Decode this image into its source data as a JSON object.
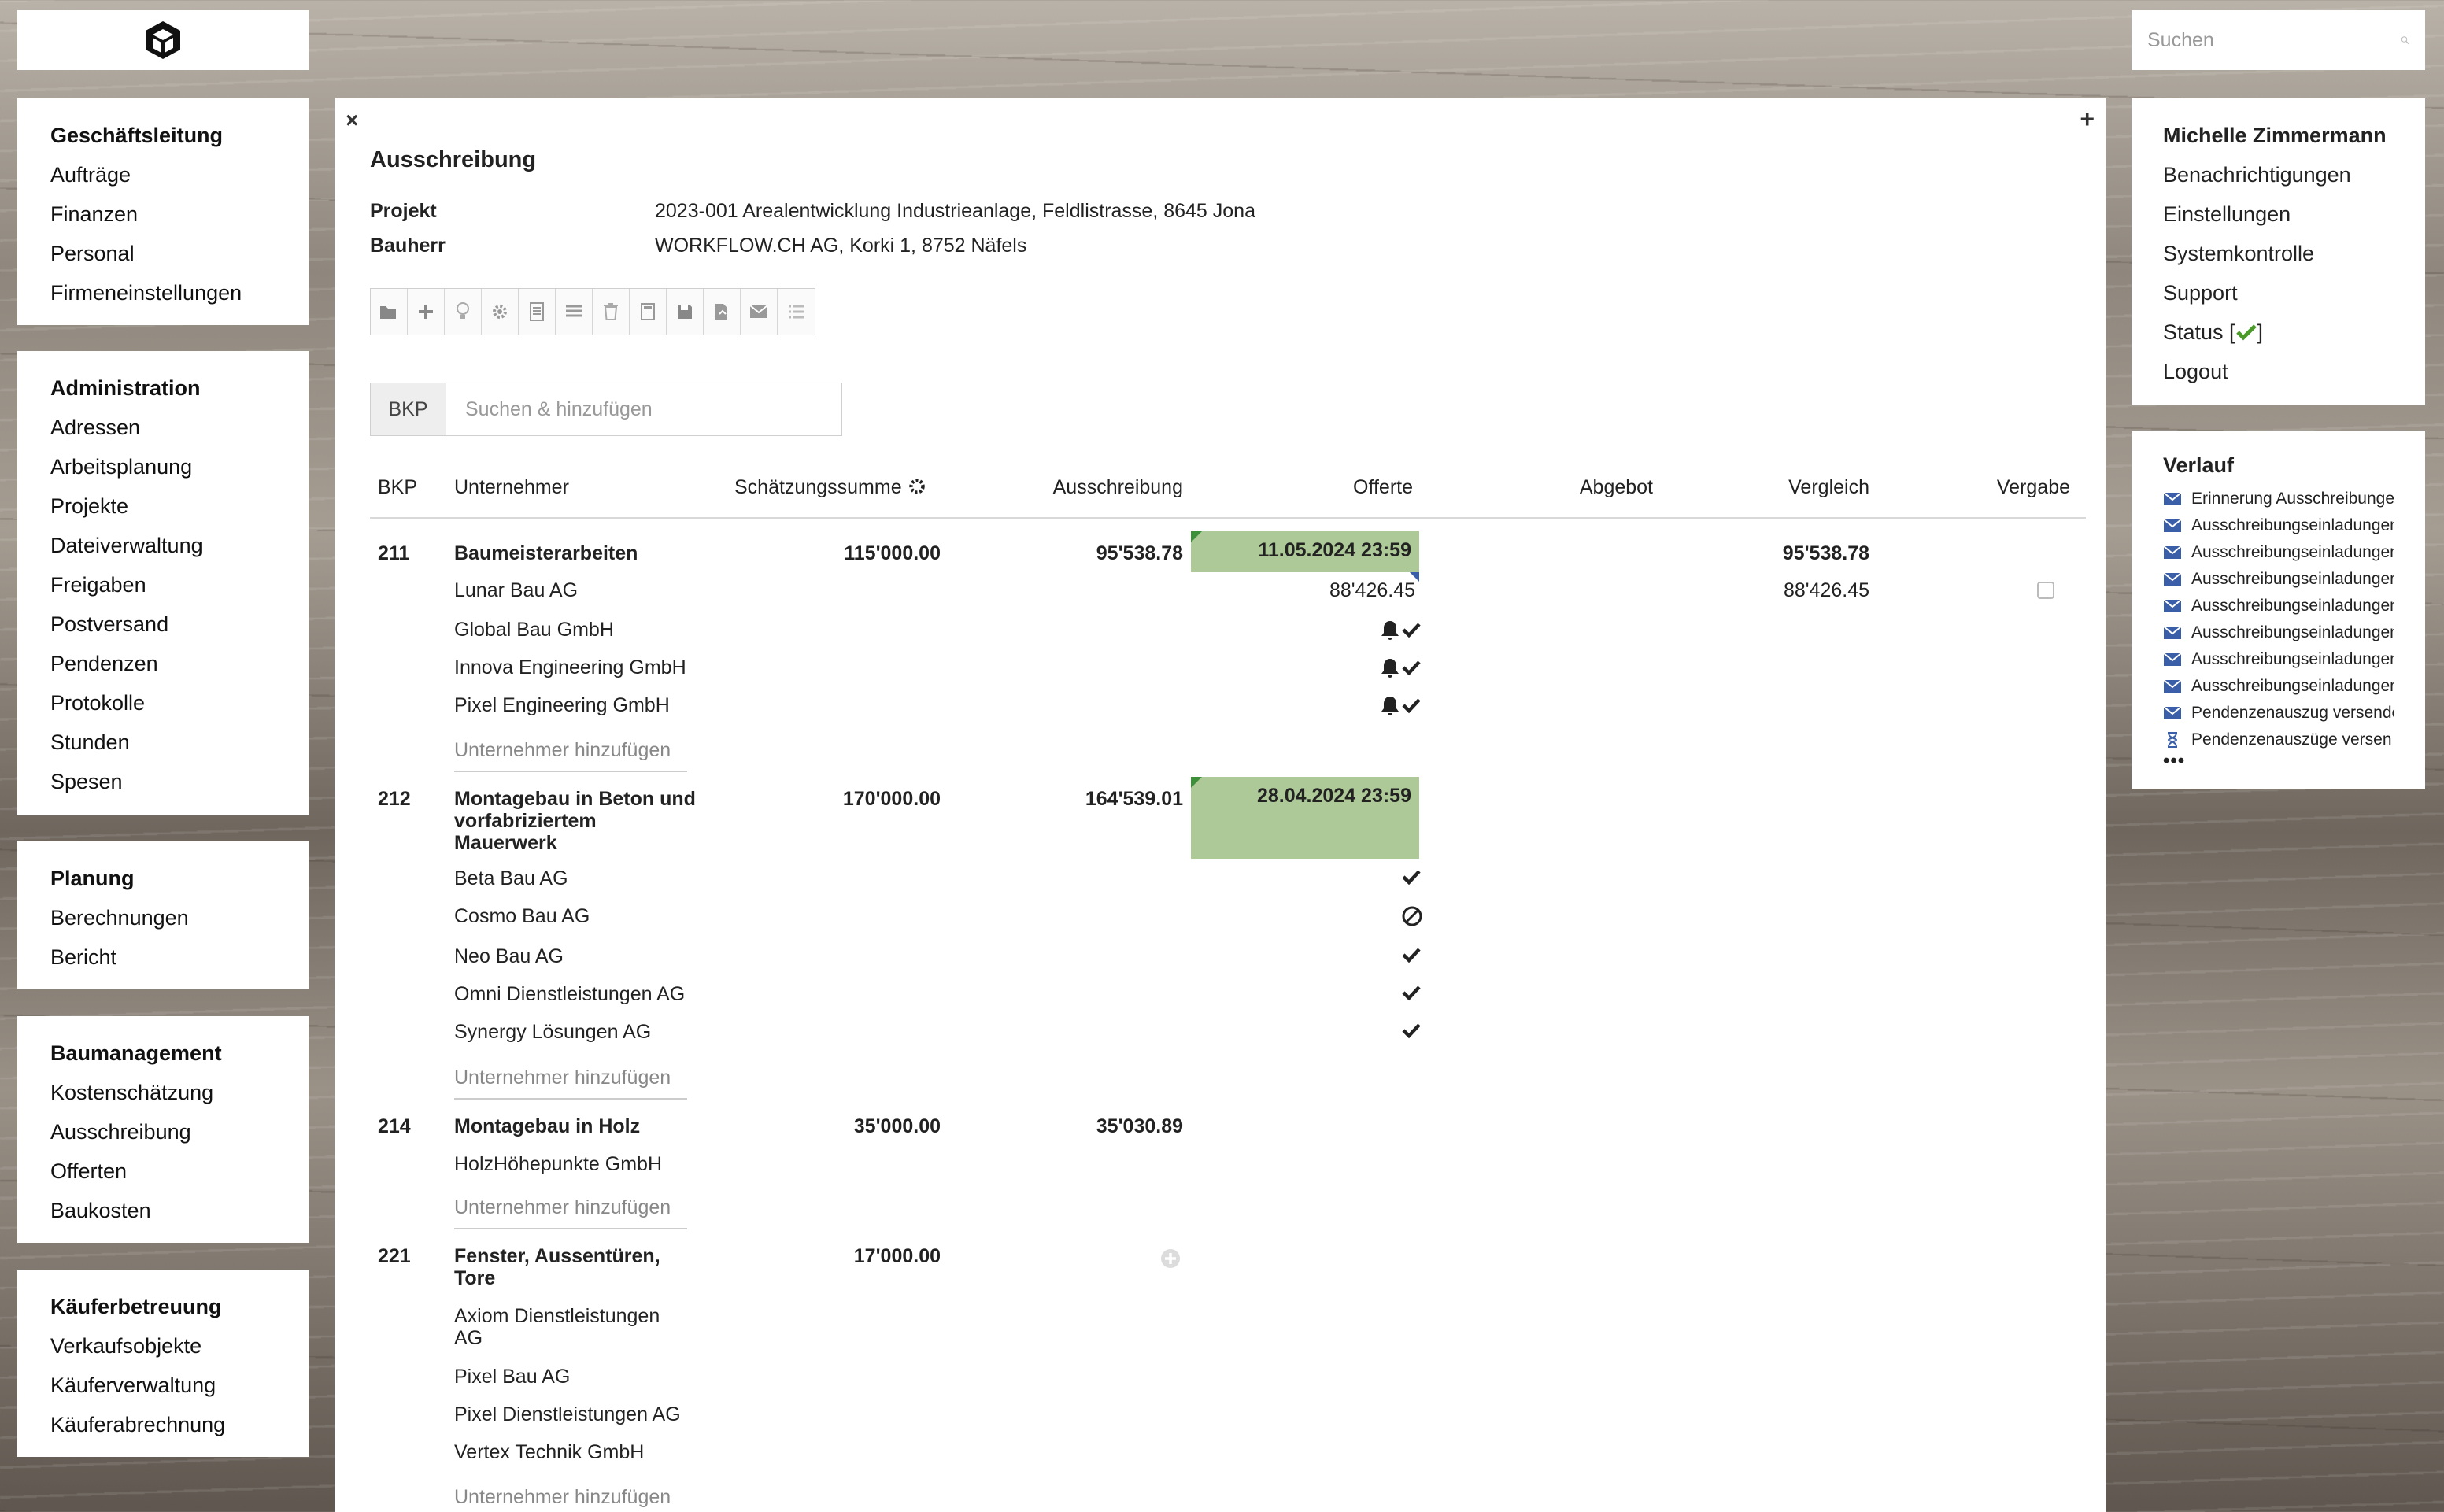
{
  "sidebar": {
    "groups": [
      {
        "title": "Geschäftsleitung",
        "items": [
          "Aufträge",
          "Finanzen",
          "Personal",
          "Firmeneinstellungen"
        ]
      },
      {
        "title": "Administration",
        "items": [
          "Adressen",
          "Arbeitsplanung",
          "Projekte",
          "Dateiverwaltung",
          "Freigaben",
          "Postversand",
          "Pendenzen",
          "Protokolle",
          "Stunden",
          "Spesen"
        ]
      },
      {
        "title": "Planung",
        "items": [
          "Berechnungen",
          "Bericht"
        ]
      },
      {
        "title": "Baumanagement",
        "items": [
          "Kostenschätzung",
          "Ausschreibung",
          "Offerten",
          "Baukosten"
        ]
      },
      {
        "title": "Käuferbetreuung",
        "items": [
          "Verkaufsobjekte",
          "Käuferverwaltung",
          "Käuferabrechnung"
        ]
      }
    ]
  },
  "search": {
    "placeholder": "Suchen"
  },
  "user": {
    "name": "Michelle Zimmermann",
    "items": [
      "Benachrichtigungen",
      "Einstellungen",
      "Systemkontrolle",
      "Support"
    ],
    "status_label": "Status [",
    "status_close": "]",
    "logout": "Logout"
  },
  "history": {
    "title": "Verlauf",
    "items": [
      {
        "icon": "mail-icon",
        "text": "Erinnerung Ausschreibungen"
      },
      {
        "icon": "mail-icon",
        "text": "Ausschreibungseinladungen"
      },
      {
        "icon": "mail-icon",
        "text": "Ausschreibungseinladungen"
      },
      {
        "icon": "mail-icon",
        "text": "Ausschreibungseinladungen"
      },
      {
        "icon": "mail-icon",
        "text": "Ausschreibungseinladungen"
      },
      {
        "icon": "mail-icon",
        "text": "Ausschreibungseinladungen"
      },
      {
        "icon": "mail-icon",
        "text": "Ausschreibungseinladungen"
      },
      {
        "icon": "mail-icon",
        "text": "Ausschreibungseinladungen"
      },
      {
        "icon": "mail-icon",
        "text": "Pendenzenauszug versendet"
      },
      {
        "icon": "hourglass-icon",
        "text": "Pendenzenauszüge versen…"
      }
    ],
    "more": "•••"
  },
  "main": {
    "close": "×",
    "plus": "+",
    "title": "Ausschreibung",
    "projekt_label": "Projekt",
    "projekt_value": "2023-001 Arealentwicklung Industrieanlage, Feldlistrasse, 8645 Jona",
    "bauherr_label": "Bauherr",
    "bauherr_value": "WORKFLOW.CH AG, Korki 1, 8752 Näfels",
    "toolbar": [
      "folder-open-icon",
      "plus-icon",
      "lightbulb-icon",
      "gear-icon",
      "document-icon",
      "list-details-icon",
      "trash-icon",
      "calculator-icon",
      "save-icon",
      "export-icon",
      "envelope-icon",
      "list-icon"
    ],
    "bkp_label": "BKP",
    "bkp_placeholder": "Suchen & hinzufügen"
  },
  "table": {
    "headers": {
      "bkp": "BKP",
      "unternehmer": "Unternehmer",
      "schaetzung": "Schätzungssumme",
      "ausschreibung": "Ausschreibung",
      "offerte": "Offerte",
      "abgebot": "Abgebot",
      "vergleich": "Vergleich",
      "vergabe": "Vergabe"
    },
    "add_label": "Unternehmer hinzufügen",
    "rows": {
      "r211": {
        "bkp": "211",
        "name": "Baumeisterarbeiten",
        "schaetzung": "115'000.00",
        "ausschreibung": "95'538.78",
        "deadline": "11.05.2024 23:59",
        "vergleich": "95'538.78",
        "companies": [
          {
            "name": "Lunar Bau AG",
            "offerte": "88'426.45",
            "vergleich": "88'426.45"
          },
          {
            "name": "Global Bau GmbH"
          },
          {
            "name": "Innova Engineering GmbH"
          },
          {
            "name": "Pixel Engineering GmbH"
          }
        ]
      },
      "r212": {
        "bkp": "212",
        "name_lines": [
          "Montagebau in Beton und",
          "vorfabriziertem",
          "Mauerwerk"
        ],
        "schaetzung": "170'000.00",
        "ausschreibung": "164'539.01",
        "deadline": "28.04.2024 23:59",
        "companies": [
          {
            "name": "Beta Bau AG"
          },
          {
            "name": "Cosmo Bau AG"
          },
          {
            "name": "Neo Bau AG"
          },
          {
            "name": "Omni Dienstleistungen AG"
          },
          {
            "name": "Synergy Lösungen AG"
          }
        ]
      },
      "r214": {
        "bkp": "214",
        "name": "Montagebau in Holz",
        "schaetzung": "35'000.00",
        "ausschreibung": "35'030.89",
        "companies": [
          {
            "name": "HolzHöhepunkte GmbH"
          }
        ]
      },
      "r221": {
        "bkp": "221",
        "name_lines": [
          "Fenster, Aussentüren,",
          "Tore"
        ],
        "schaetzung": "17'000.00",
        "companies": [
          {
            "name_lines": [
              "Axiom Dienstleistungen",
              "AG"
            ]
          },
          {
            "name": "Pixel Bau AG"
          },
          {
            "name": "Pixel Dienstleistungen AG"
          },
          {
            "name": "Vertex Technik GmbH"
          }
        ]
      }
    }
  },
  "colors": {
    "deadline_bg": "#acc997",
    "mail_icon": "#3a5fa8",
    "status_ok": "#4a9a2a"
  }
}
